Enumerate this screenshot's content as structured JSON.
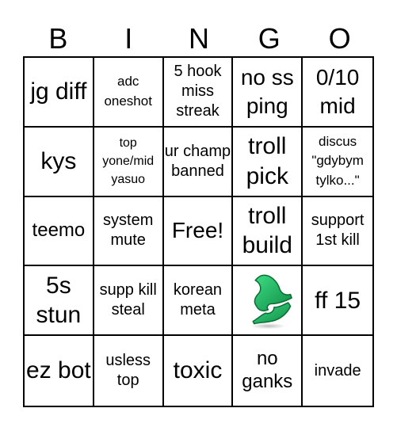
{
  "header": {
    "letters": [
      "B",
      "I",
      "N",
      "G",
      "O"
    ]
  },
  "cells": [
    [
      "jg diff",
      "adc oneshot",
      "5 hook miss streak",
      "no ss ping",
      "0/10 mid"
    ],
    [
      "kys",
      "top yone/mid yasuo",
      "ur champ banned",
      "troll pick",
      "discus \"gdybym tylko...\""
    ],
    [
      "teemo",
      "system mute",
      "Free!",
      "troll build",
      "support 1st kill"
    ],
    [
      "5s stun",
      "supp kill steal",
      "korean meta",
      "",
      "ff 15"
    ],
    [
      "ez bot",
      "usless top",
      "toxic",
      "no ganks",
      "invade"
    ]
  ],
  "icons": {
    "logo_cell": "green-swirl-logo-icon"
  },
  "colors": {
    "logo_light": "#2ecc71",
    "logo_dark": "#0b7a3b",
    "grid_line": "#000000"
  }
}
